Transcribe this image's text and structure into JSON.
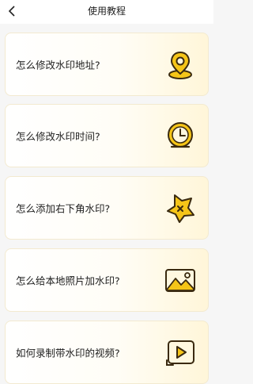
{
  "header": {
    "title": "使用教程",
    "back_icon": "chevron-left-icon"
  },
  "tutorials": [
    {
      "label": "怎么修改水印地址?",
      "icon": "location-pin-icon"
    },
    {
      "label": "怎么修改水印时间?",
      "icon": "clock-icon"
    },
    {
      "label": "怎么添加右下角水印?",
      "icon": "star-icon"
    },
    {
      "label": "怎么给本地照片加水印?",
      "icon": "image-icon"
    },
    {
      "label": "如何录制带水印的视频?",
      "icon": "video-play-icon"
    }
  ],
  "colors": {
    "accent": "#f5c518",
    "outline": "#3a2a10",
    "card_tint": "#fff6d9"
  }
}
